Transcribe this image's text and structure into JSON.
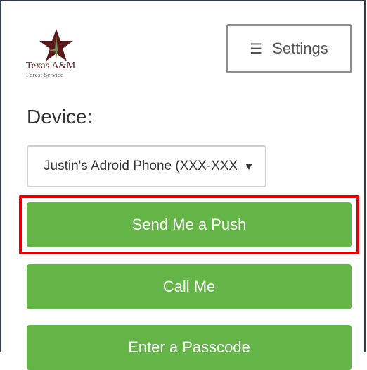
{
  "logo": {
    "name": "Texas A&M",
    "subtitle": "Forest Service",
    "colors": {
      "maroon": "#5a1a1a",
      "green": "#7a8b55"
    }
  },
  "header": {
    "settings_label": "Settings",
    "settings_icon": "menu-icon"
  },
  "device": {
    "label": "Device:",
    "selected": "Justin's Adroid Phone (XXX-XXX-"
  },
  "actions": {
    "push_label": "Send Me a Push",
    "call_label": "Call Me",
    "passcode_label": "Enter a Passcode"
  },
  "colors": {
    "button_green": "#64b447",
    "highlight_red": "#e00000"
  }
}
